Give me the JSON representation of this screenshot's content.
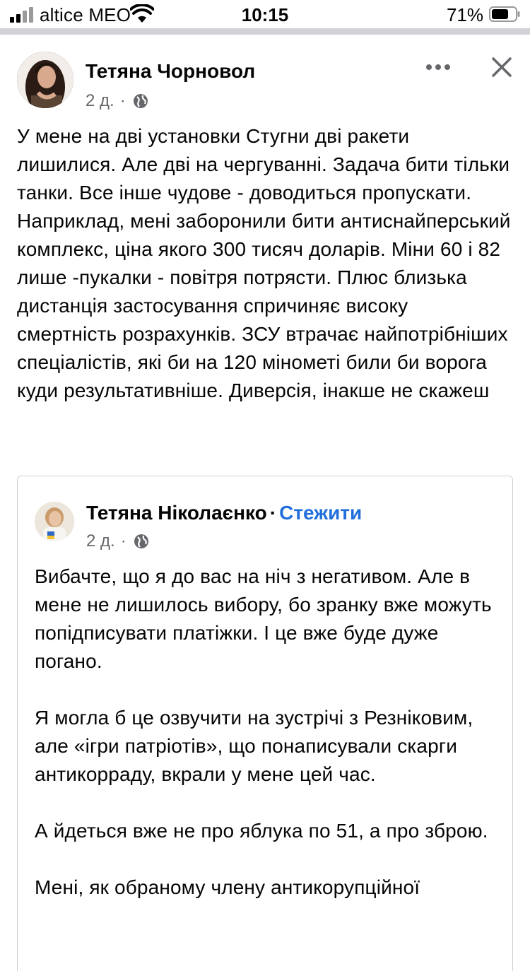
{
  "status_bar": {
    "carrier": "altice MEO",
    "time": "10:15",
    "battery_percent": "71%",
    "battery_level": 0.71,
    "signal_bars": 4
  },
  "post": {
    "author": "Тетяна Чорновол",
    "time_ago": "2 д.",
    "separator": "·",
    "privacy_icon": "globe-icon",
    "text": "У мене на дві установки Стугни дві ракети лишилися. Але дві на чергуванні. Задача бити тільки танки. Все інше чудове - доводиться пропускати. Наприклад, мені заборонили бити антиснайперський комплекс, ціна якого 300 тисяч доларів. Міни 60 і 82 лише -пукалки - повітря потрясти. Плюс близька дистанція застосування спричиняє високу смертність розрахунків. ЗСУ втрачає найпотрібніших спеціалістів, які би на 120 мінометі били би ворога куди результативніше. Диверсія, інакше не скажеш"
  },
  "shared_post": {
    "author": "Тетяна Ніколаєнко",
    "separator": "·",
    "follow_label": "Стежити",
    "time_ago": "2 д.",
    "paragraphs": [
      "Вибачте, що я до вас на ніч з негативом. Але в мене не лишилось вибору, бо зранку вже можуть попідписувати платіжки. І це вже буде дуже погано.",
      "Я могла б це озвучити на зустрічі з Резніковим, але «ігри патріотів», що понаписували скарги антикорраду, вкрали у мене цей час.",
      "А йдеться вже не про яблука по 51, а про зброю.",
      "Мені, як обраному члену антикорупційної"
    ]
  },
  "colors": {
    "link": "#216fdb",
    "secondary_text": "#65676b",
    "divider": "#d0d2d6"
  }
}
